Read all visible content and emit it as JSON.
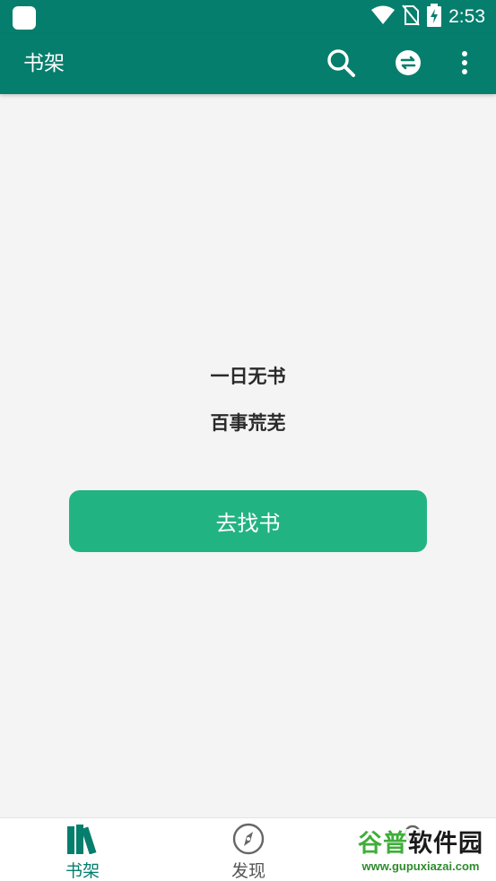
{
  "status_bar": {
    "time": "2:53",
    "icons": [
      "app-icon",
      "wifi-icon",
      "no-sim-icon",
      "battery-charging-icon"
    ]
  },
  "app_bar": {
    "title": "书架",
    "actions": [
      "search-icon",
      "convert-icon",
      "more-vert-icon"
    ]
  },
  "empty_state": {
    "line1": "一日无书",
    "line2": "百事荒芜",
    "button_label": "去找书"
  },
  "bottom_nav": {
    "items": [
      {
        "label": "书架",
        "icon": "bookshelf-icon",
        "active": true
      },
      {
        "label": "发现",
        "icon": "compass-icon",
        "active": false
      },
      {
        "label": "",
        "icon": "profile-icon",
        "active": false
      }
    ]
  },
  "watermark": {
    "logo_a": "谷普",
    "logo_b": "软件园",
    "url": "www.gupuxiazai.com"
  },
  "colors": {
    "primary": "#067e6d",
    "accent_button": "#22b382",
    "background": "#f4f4f4"
  }
}
